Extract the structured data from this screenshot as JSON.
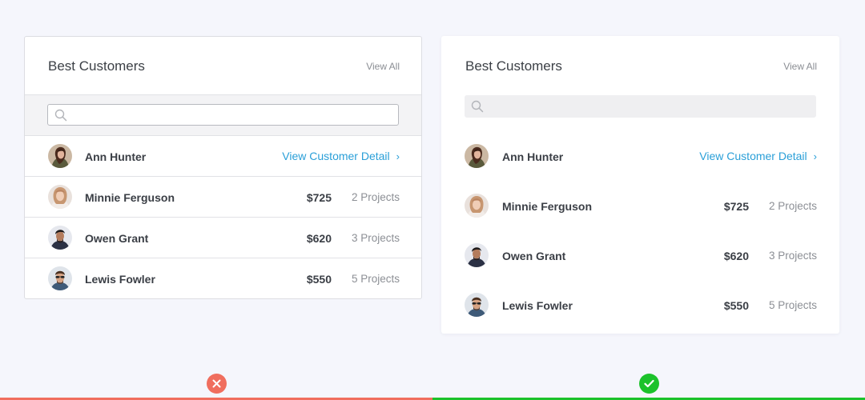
{
  "bad_card": {
    "title": "Best Customers",
    "view_all": "View All",
    "search_placeholder": "",
    "customers": [
      {
        "name": "Ann Hunter",
        "detail_label": "View Customer Detail",
        "chevron": "›"
      },
      {
        "name": "Minnie Ferguson",
        "amount": "$725",
        "projects": "2 Projects"
      },
      {
        "name": "Owen Grant",
        "amount": "$620",
        "projects": "3 Projects"
      },
      {
        "name": "Lewis Fowler",
        "amount": "$550",
        "projects": "5 Projects"
      }
    ]
  },
  "good_card": {
    "title": "Best Customers",
    "view_all": "View All",
    "search_placeholder": "",
    "customers": [
      {
        "name": "Ann Hunter",
        "detail_label": "View Customer Detail",
        "chevron": "›"
      },
      {
        "name": "Minnie Ferguson",
        "amount": "$725",
        "projects": "2 Projects"
      },
      {
        "name": "Owen Grant",
        "amount": "$620",
        "projects": "3 Projects"
      },
      {
        "name": "Lewis Fowler",
        "amount": "$550",
        "projects": "5 Projects"
      }
    ]
  },
  "indicators": {
    "bad_icon": "close-icon",
    "good_icon": "check-icon",
    "bad_color": "#f06e5e",
    "good_color": "#1cc22b"
  },
  "colors": {
    "background": "#f5f6fc",
    "link": "#2a9fd8"
  }
}
